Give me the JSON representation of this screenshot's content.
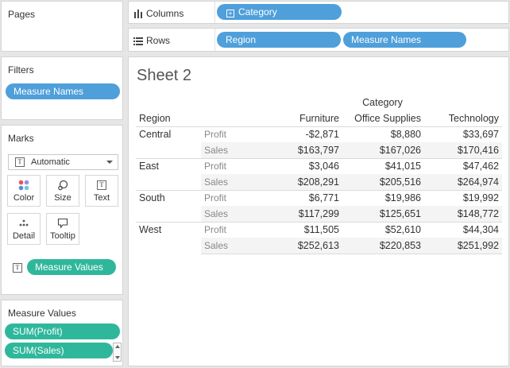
{
  "pages_panel": {
    "title": "Pages"
  },
  "filters_panel": {
    "title": "Filters",
    "pills": [
      "Measure Names"
    ]
  },
  "marks_panel": {
    "title": "Marks",
    "mark_type": "Automatic",
    "buttons": {
      "color": "Color",
      "size": "Size",
      "text": "Text",
      "detail": "Detail",
      "tooltip": "Tooltip"
    },
    "text_pill": "Measure Values"
  },
  "measure_values_panel": {
    "title": "Measure Values",
    "pills": [
      "SUM(Profit)",
      "SUM(Sales)"
    ]
  },
  "columns_shelf": {
    "label": "Columns",
    "pills": [
      "Category"
    ]
  },
  "rows_shelf": {
    "label": "Rows",
    "pills": [
      "Region",
      "Measure Names"
    ]
  },
  "sheet": {
    "title": "Sheet 2",
    "column_group_header": "Category",
    "row_header": "Region",
    "columns": [
      "Furniture",
      "Office Supplies",
      "Technology"
    ],
    "rows": [
      {
        "region": "Central",
        "measures": [
          {
            "name": "Profit",
            "values": [
              "-$2,871",
              "$8,880",
              "$33,697"
            ]
          },
          {
            "name": "Sales",
            "values": [
              "$163,797",
              "$167,026",
              "$170,416"
            ]
          }
        ]
      },
      {
        "region": "East",
        "measures": [
          {
            "name": "Profit",
            "values": [
              "$3,046",
              "$41,015",
              "$47,462"
            ]
          },
          {
            "name": "Sales",
            "values": [
              "$208,291",
              "$205,516",
              "$264,974"
            ]
          }
        ]
      },
      {
        "region": "South",
        "measures": [
          {
            "name": "Profit",
            "values": [
              "$6,771",
              "$19,986",
              "$19,992"
            ]
          },
          {
            "name": "Sales",
            "values": [
              "$117,299",
              "$125,651",
              "$148,772"
            ]
          }
        ]
      },
      {
        "region": "West",
        "measures": [
          {
            "name": "Profit",
            "values": [
              "$11,505",
              "$52,610",
              "$44,304"
            ]
          },
          {
            "name": "Sales",
            "values": [
              "$252,613",
              "$220,853",
              "$251,992"
            ]
          }
        ]
      }
    ]
  },
  "colors": {
    "blue_pill": "#4f9fda",
    "green_pill": "#2fb79b",
    "color_dots": [
      "#e15759",
      "#9b8fd8",
      "#5a8fd0",
      "#79c3e6"
    ]
  }
}
